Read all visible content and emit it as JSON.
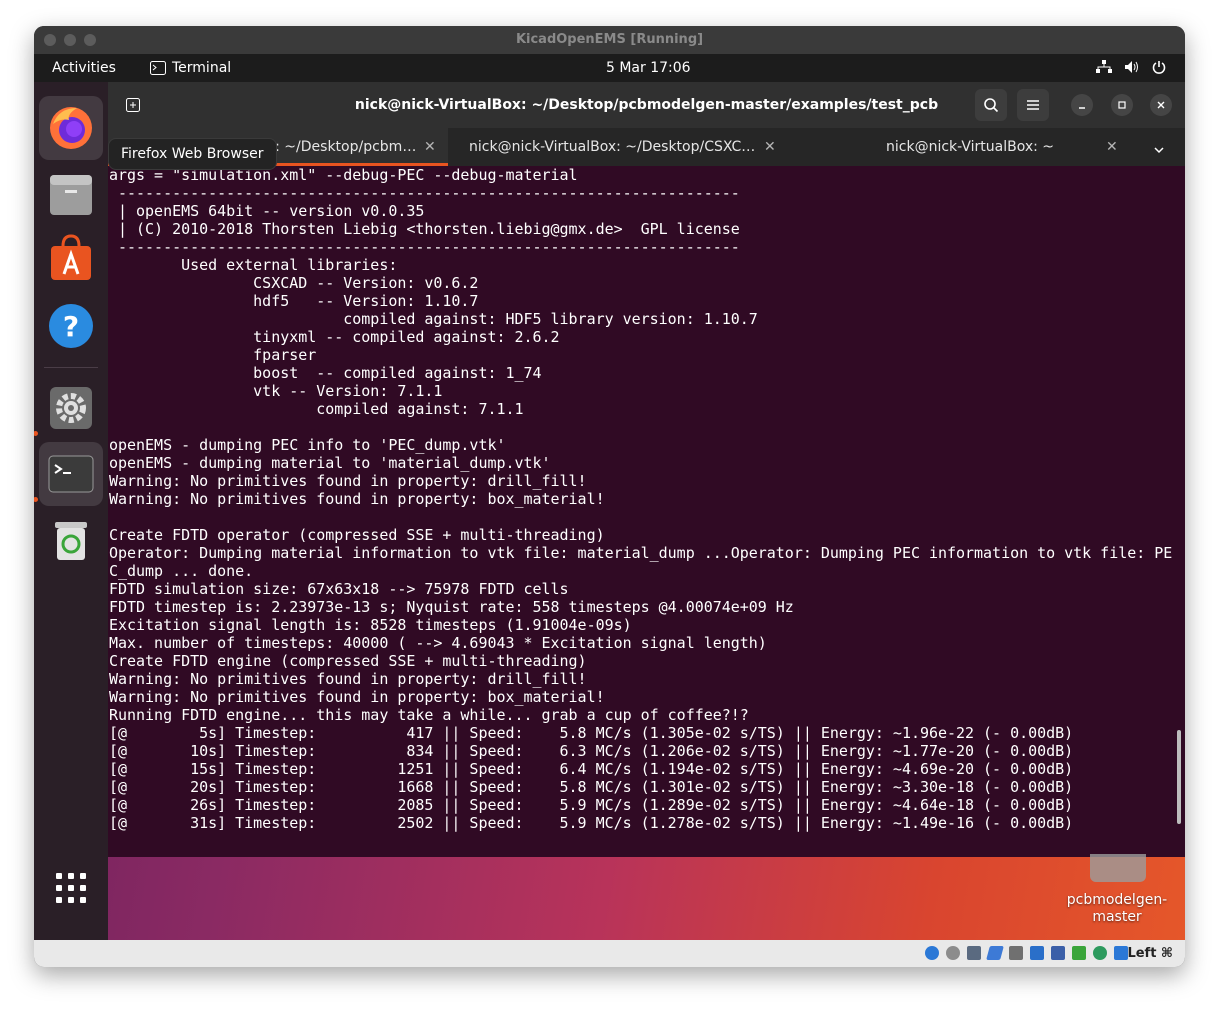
{
  "vbox": {
    "title": "KicadOpenEMS [Running]"
  },
  "topbar": {
    "activities": "Activities",
    "app_name": "Terminal",
    "clock": "5 Mar  17:06"
  },
  "tooltip": "Firefox Web Browser",
  "terminal": {
    "title": "nick@nick-VirtualBox: ~/Desktop/pcbmodelgen-master/examples/test_pcb",
    "tabs": [
      {
        "label": "nick@nick-VirtualBox: ~/Desktop/pcbm…"
      },
      {
        "label": "nick@nick-VirtualBox: ~/Desktop/CSXC…"
      },
      {
        "label": "nick@nick-VirtualBox: ~"
      }
    ],
    "lines": [
      "args = \"simulation.xml\" --debug-PEC --debug-material",
      " ---------------------------------------------------------------------",
      " | openEMS 64bit -- version v0.0.35",
      " | (C) 2010-2018 Thorsten Liebig <thorsten.liebig@gmx.de>  GPL license",
      " ---------------------------------------------------------------------",
      "        Used external libraries:",
      "                CSXCAD -- Version: v0.6.2",
      "                hdf5   -- Version: 1.10.7",
      "                          compiled against: HDF5 library version: 1.10.7",
      "                tinyxml -- compiled against: 2.6.2",
      "                fparser",
      "                boost  -- compiled against: 1_74",
      "                vtk -- Version: 7.1.1",
      "                       compiled against: 7.1.1",
      "",
      "openEMS - dumping PEC info to 'PEC_dump.vtk'",
      "openEMS - dumping material to 'material_dump.vtk'",
      "Warning: No primitives found in property: drill_fill!",
      "Warning: No primitives found in property: box_material!",
      "",
      "Create FDTD operator (compressed SSE + multi-threading)",
      "Operator: Dumping material information to vtk file: material_dump ...Operator: Dumping PEC information to vtk file: PE",
      "C_dump ... done.",
      "FDTD simulation size: 67x63x18 --> 75978 FDTD cells",
      "FDTD timestep is: 2.23973e-13 s; Nyquist rate: 558 timesteps @4.00074e+09 Hz",
      "Excitation signal length is: 8528 timesteps (1.91004e-09s)",
      "Max. number of timesteps: 40000 ( --> 4.69043 * Excitation signal length)",
      "Create FDTD engine (compressed SSE + multi-threading)",
      "Warning: No primitives found in property: drill_fill!",
      "Warning: No primitives found in property: box_material!",
      "Running FDTD engine... this may take a while... grab a cup of coffee?!?",
      "[@        5s] Timestep:          417 || Speed:    5.8 MC/s (1.305e-02 s/TS) || Energy: ~1.96e-22 (- 0.00dB)",
      "[@       10s] Timestep:          834 || Speed:    6.3 MC/s (1.206e-02 s/TS) || Energy: ~1.77e-20 (- 0.00dB)",
      "[@       15s] Timestep:         1251 || Speed:    6.4 MC/s (1.194e-02 s/TS) || Energy: ~4.69e-20 (- 0.00dB)",
      "[@       20s] Timestep:         1668 || Speed:    5.8 MC/s (1.301e-02 s/TS) || Energy: ~3.30e-18 (- 0.00dB)",
      "[@       26s] Timestep:         2085 || Speed:    5.9 MC/s (1.289e-02 s/TS) || Energy: ~4.64e-18 (- 0.00dB)",
      "[@       31s] Timestep:         2502 || Speed:    5.9 MC/s (1.278e-02 s/TS) || Energy: ~1.49e-16 (- 0.00dB)"
    ]
  },
  "desktop_icon": {
    "label": "pcbmodelgen-\nmaster"
  },
  "statusbar": {
    "host_key": "Left ⌘"
  },
  "colors": {
    "ubuntu_orange": "#e95420",
    "terminal_bg": "#300a24"
  }
}
